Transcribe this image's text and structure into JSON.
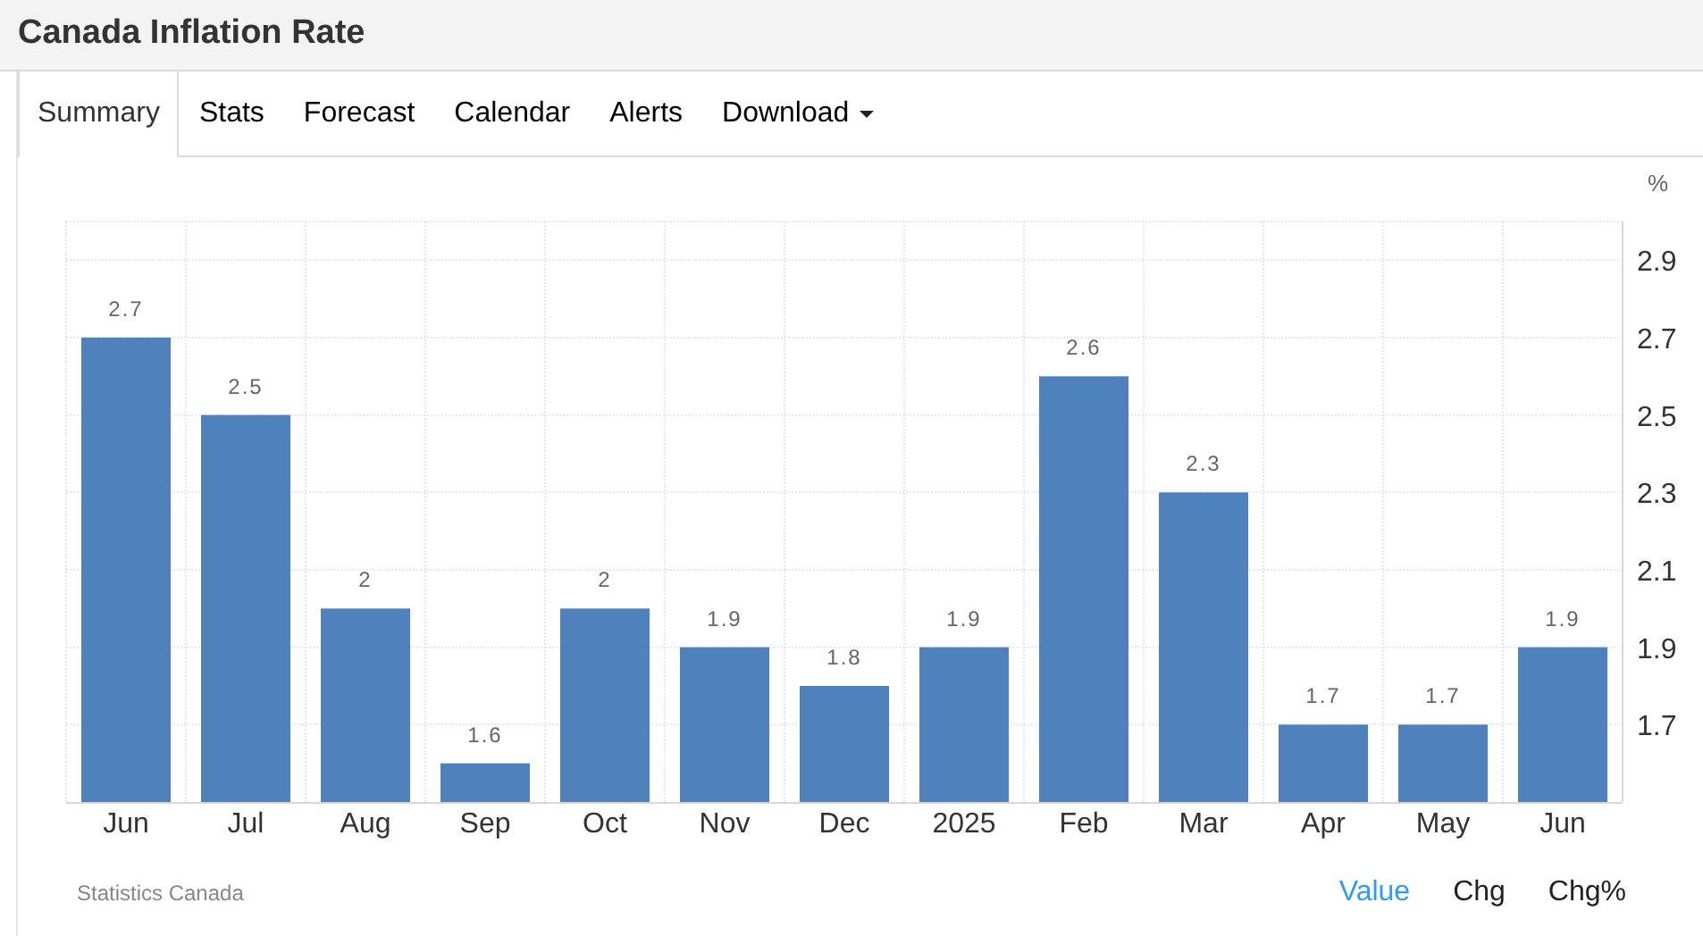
{
  "title": "Canada Inflation Rate",
  "tabs": [
    {
      "label": "Summary",
      "selected": true
    },
    {
      "label": "Stats",
      "selected": false
    },
    {
      "label": "Forecast",
      "selected": false
    },
    {
      "label": "Calendar",
      "selected": false
    },
    {
      "label": "Alerts",
      "selected": false
    },
    {
      "label": "Download",
      "selected": false,
      "dropdown": true
    }
  ],
  "chart_data": {
    "type": "bar",
    "ylabel": "%",
    "categories": [
      "Jun",
      "Jul",
      "Aug",
      "Sep",
      "Oct",
      "Nov",
      "Dec",
      "2025",
      "Feb",
      "Mar",
      "Apr",
      "May",
      "Jun"
    ],
    "series": [
      {
        "color": "#4f81bd",
        "values": [
          2.7,
          2.5,
          2.0,
          1.6,
          2.0,
          1.9,
          1.8,
          1.9,
          2.6,
          2.3,
          1.7,
          1.7,
          1.9
        ]
      }
    ],
    "data_labels": true,
    "grid": true,
    "ylim": [
      1.5,
      3.0
    ],
    "yticks": [
      1.7,
      1.9,
      2.1,
      2.3,
      2.5,
      2.7,
      2.9
    ]
  },
  "source": "Statistics Canada",
  "toggles": [
    {
      "label": "Value",
      "selected": true
    },
    {
      "label": "Chg",
      "selected": false
    },
    {
      "label": "Chg%",
      "selected": false
    }
  ]
}
